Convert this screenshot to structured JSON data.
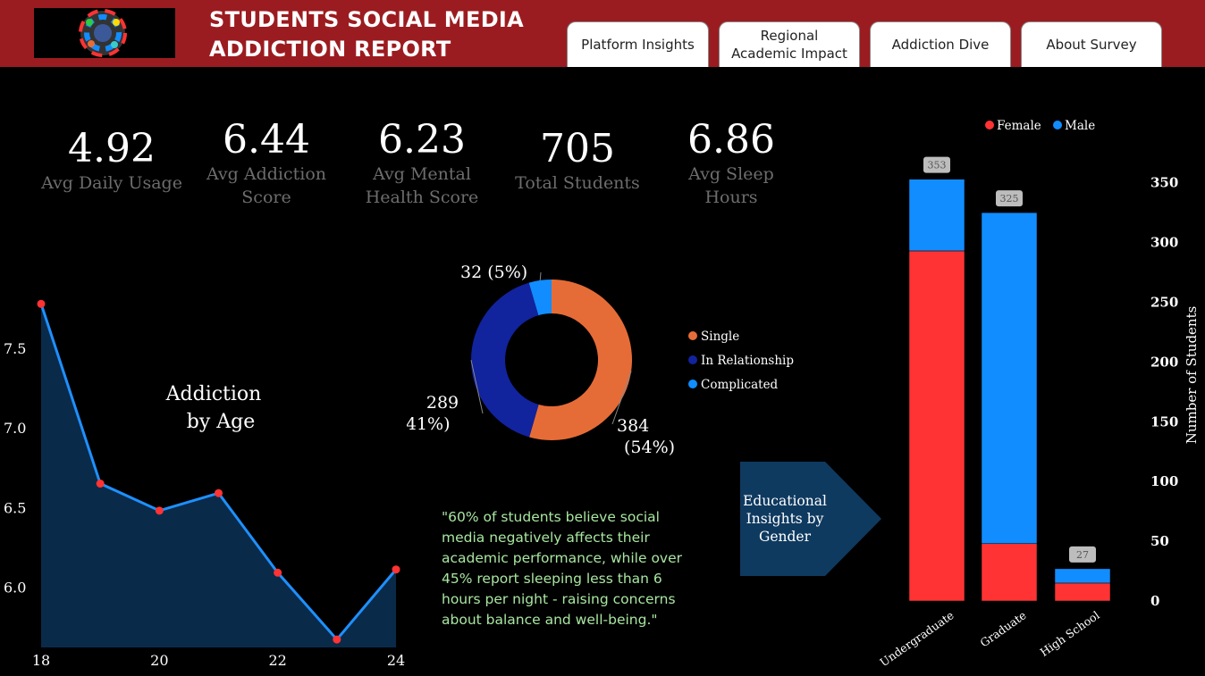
{
  "header": {
    "title_line1": "STUDENTS SOCIAL MEDIA",
    "title_line2": "ADDICTION REPORT",
    "logo_icon": "social-media-globe-icon",
    "tabs": [
      {
        "label": "Platform Insights"
      },
      {
        "label": "Regional Academic Impact"
      },
      {
        "label": "Addiction Dive"
      },
      {
        "label": "About Survey"
      }
    ]
  },
  "kpis": [
    {
      "value": "4.92",
      "label": "Avg Daily Usage"
    },
    {
      "value": "6.44",
      "label": "Avg Addiction\nScore"
    },
    {
      "value": "6.23",
      "label": "Avg Mental\nHealth Score"
    },
    {
      "value": "705",
      "label": "Total Students"
    },
    {
      "value": "6.86",
      "label": "Avg Sleep\nHours"
    }
  ],
  "quote": "\"60% of students believe social media negatively affects their academic performance, while over 45% report sleeping less than 6 hours per night - raising concerns about balance and well-being.\"",
  "arrow_label": "Educational Insights by Gender",
  "colors": {
    "header": "#9b1c20",
    "female": "#ff3333",
    "male": "#118dff",
    "single": "#e66c37",
    "relationship": "#12239e",
    "complicated": "#118dff",
    "area_fill": "#0a2a4a",
    "line": "#1e90ff"
  },
  "chart_data": [
    {
      "type": "area",
      "title": "Addiction by Age",
      "x": [
        18,
        19,
        20,
        21,
        22,
        23,
        24
      ],
      "y": [
        7.78,
        6.65,
        6.48,
        6.59,
        6.09,
        5.67,
        6.11
      ],
      "x_ticks": [
        "18",
        "20",
        "22",
        "24"
      ],
      "y_ticks": [
        "6.0",
        "6.5",
        "7.0",
        "7.5"
      ],
      "ylim": [
        5.62,
        7.95
      ]
    },
    {
      "type": "pie",
      "donut": true,
      "labels": [
        "Single",
        "In Relationship",
        "Complicated"
      ],
      "values": [
        384,
        289,
        32
      ],
      "data_labels": [
        "384\n(54%)",
        "289\n(41%)",
        "32 (5%)"
      ],
      "colors": [
        "#e66c37",
        "#12239e",
        "#118dff"
      ],
      "legend": "right"
    },
    {
      "type": "bar",
      "stacked": true,
      "categories": [
        "Undergraduate",
        "Graduate",
        "High School"
      ],
      "series": [
        {
          "name": "Female",
          "values": [
            293,
            48,
            15
          ]
        },
        {
          "name": "Male",
          "values": [
            60,
            277,
            12
          ]
        }
      ],
      "totals": [
        353,
        325,
        27
      ],
      "ylabel": "Number of Students",
      "y_ticks": [
        "0",
        "50",
        "100",
        "150",
        "200",
        "250",
        "300",
        "350"
      ],
      "ylim": [
        0,
        355
      ],
      "legend": "top"
    }
  ]
}
